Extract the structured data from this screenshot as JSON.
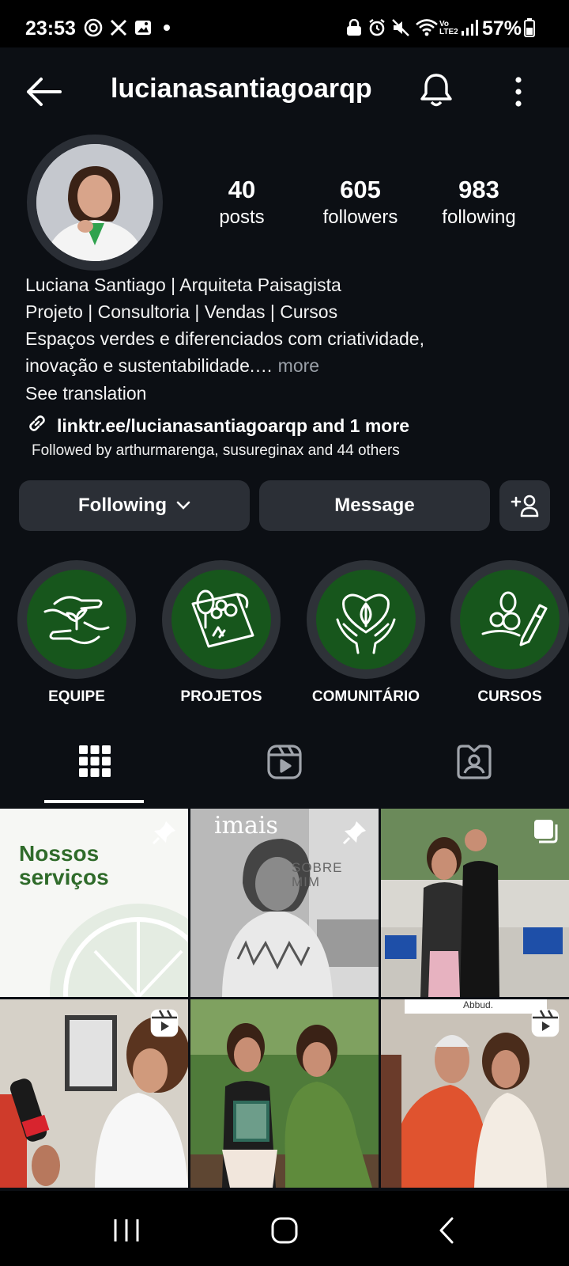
{
  "status_bar": {
    "time": "23:53",
    "network_label": "Vo LTE2",
    "battery": "57%",
    "icons": [
      "threads-icon",
      "x-icon",
      "gallery-icon",
      "dot-icon",
      "lock-icon",
      "alarm-icon",
      "mute-icon",
      "wifi-icon",
      "signal-icon",
      "battery-icon"
    ]
  },
  "header": {
    "username": "lucianasantiagoarqp",
    "icons": [
      "back-arrow-icon",
      "bell-icon",
      "more-vertical-icon"
    ]
  },
  "profile": {
    "stats": [
      {
        "value": "40",
        "label": "posts"
      },
      {
        "value": "605",
        "label": "followers"
      },
      {
        "value": "983",
        "label": "following"
      }
    ],
    "bio_lines": [
      "Luciana Santiago | Arquiteta Paisagista",
      "Projeto | Consultoria | Vendas | Cursos",
      "Espaços verdes e diferenciados com criatividade,",
      "inovação e sustentabilidade.…"
    ],
    "bio_more": " more",
    "see_translation": "See translation",
    "link": "linktr.ee/lucianasantiagoarqp and 1 more",
    "followed_by": "Followed by arthurmarenga, susureginax and 44 others"
  },
  "actions": {
    "following": "Following",
    "message": "Message"
  },
  "highlights": [
    {
      "label": "EQUIPE",
      "icon": "hands-plant-icon"
    },
    {
      "label": "PROJETOS",
      "icon": "landscape-plan-icon"
    },
    {
      "label": "COMUNITÁRIO",
      "icon": "hands-heart-leaf-icon"
    },
    {
      "label": "CURSOS",
      "icon": "drawing-pencil-icon"
    }
  ],
  "tabs": [
    "grid-icon",
    "reels-icon",
    "tagged-icon"
  ],
  "posts": {
    "post1_text": "Nossos serviços",
    "post2_brand": "imais",
    "post2_text": "SOBRE MIM",
    "post6_text": "Abbud.",
    "badges": [
      "pin-icon",
      "pin-icon",
      "carousel-icon",
      "reel-icon",
      "reel-icon"
    ]
  },
  "colors": {
    "background": "#0c0f14",
    "button": "#2b2f36",
    "highlight_green": "#17561c",
    "muted_text": "#9aa0a8"
  }
}
